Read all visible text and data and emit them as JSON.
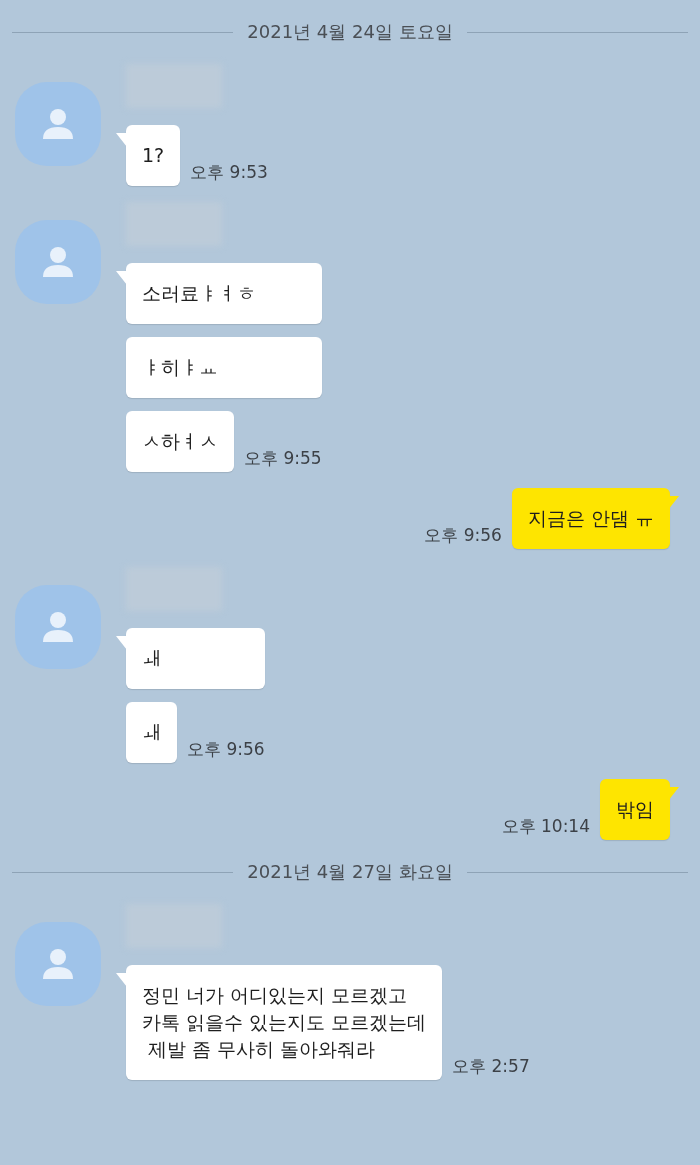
{
  "feed": [
    {
      "kind": "date",
      "text": "2021년 4월 24일 토요일"
    },
    {
      "kind": "incoming",
      "messages": [
        "1?"
      ],
      "time": "오후 9:53"
    },
    {
      "kind": "incoming",
      "messages": [
        "소러료ㅑㅕㅎ",
        "ㅑ히ㅑㅛ",
        "ㅅ하ㅕㅅ"
      ],
      "time": "오후 9:55"
    },
    {
      "kind": "outgoing",
      "messages": [
        "지금은 안댐 ㅠ"
      ],
      "time": "오후 9:56"
    },
    {
      "kind": "incoming",
      "messages": [
        "ㅙ",
        "ㅙ"
      ],
      "time": "오후 9:56"
    },
    {
      "kind": "outgoing",
      "messages": [
        "밖임"
      ],
      "time": "오후 10:14"
    },
    {
      "kind": "date",
      "text": "2021년 4월 27일 화요일"
    },
    {
      "kind": "incoming",
      "messages": [
        "정민 너가 어디있는지 모르겠고\n카톡 읽을수 있는지도 모르겠는데\n 제발 좀 무사히 돌아와줘라"
      ],
      "time": "오후 2:57"
    }
  ]
}
